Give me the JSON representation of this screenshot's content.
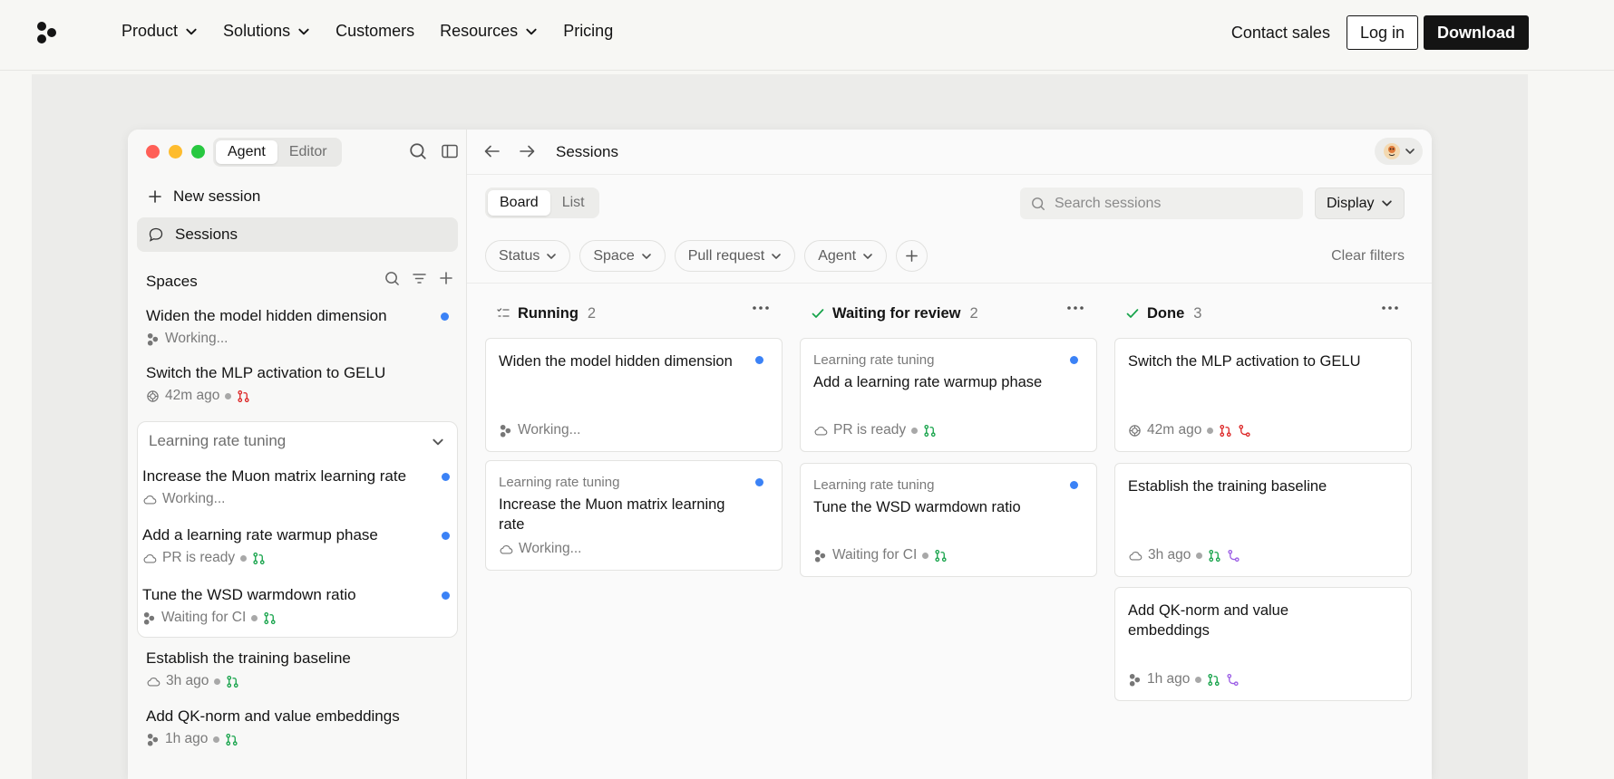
{
  "nav": {
    "links": [
      "Product",
      "Solutions",
      "Customers",
      "Resources",
      "Pricing"
    ],
    "contact_sales": "Contact sales",
    "login": "Log in",
    "download": "Download"
  },
  "sidebar": {
    "mode_tabs": [
      "Agent",
      "Editor"
    ],
    "new_session": "New session",
    "sessions": "Sessions",
    "spaces_label": "Spaces",
    "items_top": [
      {
        "title": "Widen the model hidden dimension",
        "meta": "Working...",
        "unread": true
      },
      {
        "title": "Switch the MLP activation to GELU",
        "meta": "42m ago",
        "unread": false
      }
    ],
    "group": {
      "name": "Learning rate tuning",
      "items": [
        {
          "title": "Increase the Muon matrix learning rate",
          "meta": "Working...",
          "unread": true
        },
        {
          "title": "Add a learning rate warmup phase",
          "meta": "PR is ready",
          "unread": true
        },
        {
          "title": "Tune the WSD warmdown ratio",
          "meta": "Waiting for CI",
          "unread": true
        }
      ]
    },
    "items_bottom": [
      {
        "title": "Establish the training baseline",
        "meta": "3h ago"
      },
      {
        "title": "Add QK-norm and value embeddings",
        "meta": "1h ago"
      }
    ]
  },
  "main": {
    "title": "Sessions",
    "view_tabs": [
      "Board",
      "List"
    ],
    "search_placeholder": "Search sessions",
    "display": "Display",
    "filters": [
      "Status",
      "Space",
      "Pull request",
      "Agent"
    ],
    "clear_filters": "Clear filters",
    "columns": [
      {
        "name": "Running",
        "count": "2",
        "cards": [
          {
            "space": "",
            "title": "Widen the model hidden dimension",
            "meta": "Working...",
            "unread": true
          },
          {
            "space": "Learning rate tuning",
            "title": "Increase the Muon matrix learning rate",
            "meta": "Working...",
            "unread": true
          }
        ]
      },
      {
        "name": "Waiting for review",
        "count": "2",
        "cards": [
          {
            "space": "Learning rate tuning",
            "title": "Add a learning rate warmup phase",
            "meta": "PR is ready",
            "unread": true
          },
          {
            "space": "Learning rate tuning",
            "title": "Tune the WSD warmdown ratio",
            "meta": "Waiting for CI",
            "unread": true
          }
        ]
      },
      {
        "name": "Done",
        "count": "3",
        "cards": [
          {
            "space": "",
            "title": "Switch the MLP activation to GELU",
            "meta": "42m ago",
            "unread": false
          },
          {
            "space": "",
            "title": "Establish the training baseline",
            "meta": "3h ago",
            "unread": false
          },
          {
            "space": "",
            "title": "Add QK-norm and value embeddings",
            "meta": "1h ago",
            "unread": false
          }
        ]
      }
    ]
  },
  "colors": {
    "accent_blue": "#3b82f6",
    "pr_green": "#16a34a",
    "pr_red": "#dc2626",
    "merge_purple": "#9b5de5",
    "traffic": [
      "#ff5f57",
      "#febc2e",
      "#28c840"
    ]
  },
  "icons": [
    "logo-icon",
    "chevron-down-icon",
    "search-icon",
    "sidebar-toggle-icon",
    "plus-icon",
    "chat-bubble-icon",
    "filter-icon",
    "agent-icon",
    "cloud-icon",
    "openai-icon",
    "pull-request-icon",
    "merged-icon",
    "arrow-left-icon",
    "arrow-right-icon",
    "more-icon",
    "checklist-icon",
    "check-icon"
  ]
}
